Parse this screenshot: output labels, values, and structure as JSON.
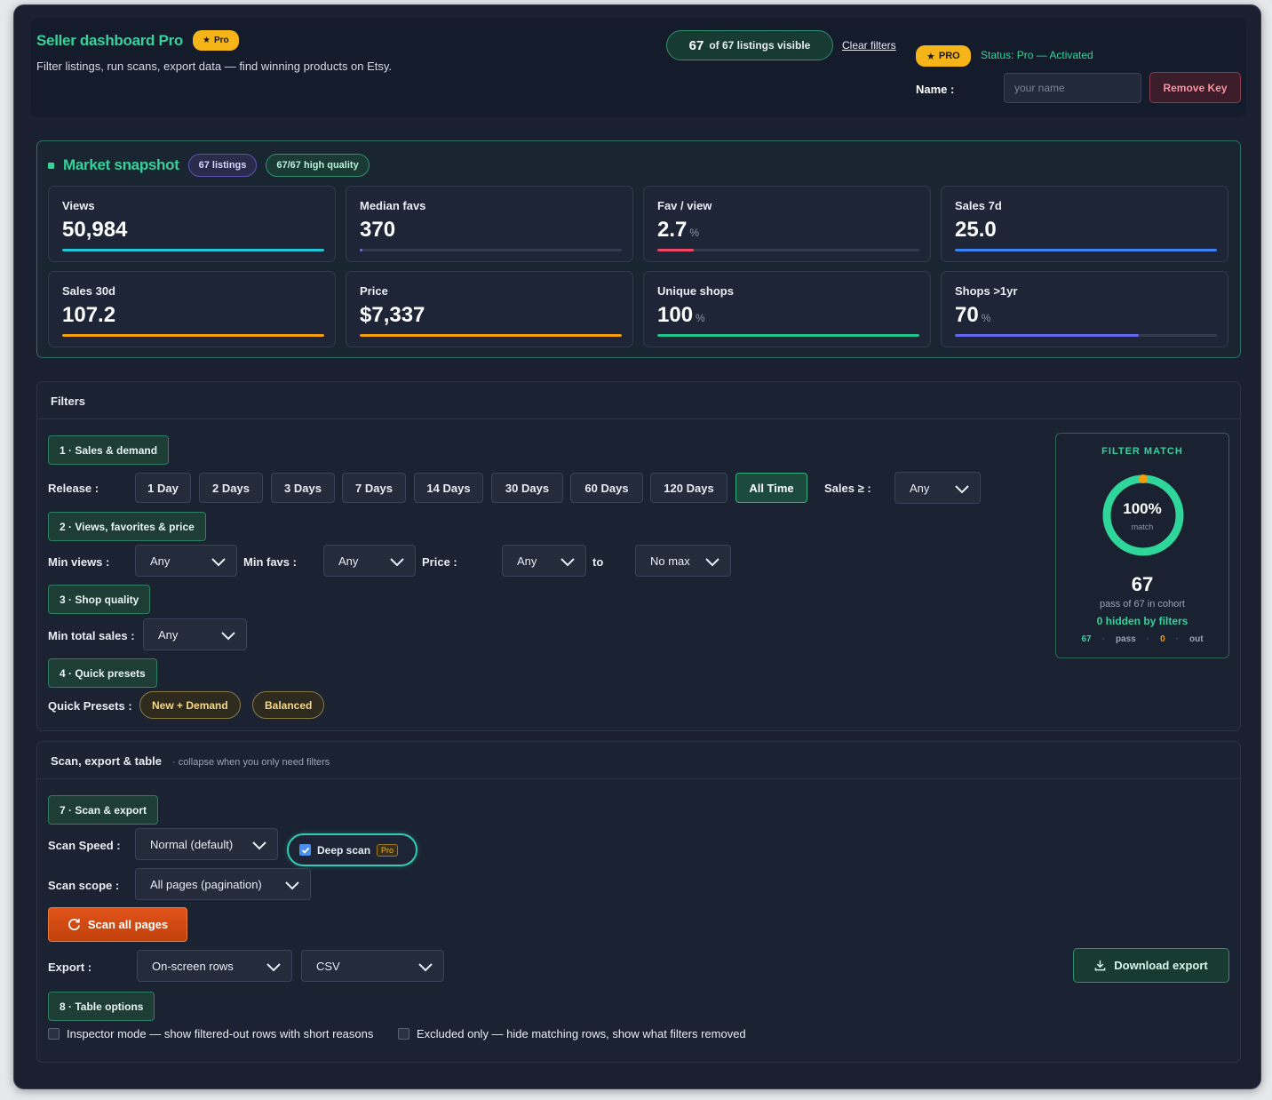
{
  "header": {
    "brand": "Seller dashboard Pro",
    "brand_badge": "Pro",
    "subtitle": "Filter listings, run scans, export data — find winning products on Etsy.",
    "visible_count": "67",
    "visible_text": "of 67 listings visible",
    "clear_filters": "Clear filters",
    "pro_badge": "PRO",
    "status": "Status: Pro — Activated",
    "name_label": "Name :",
    "name_placeholder": "your name",
    "remove_key": "Remove Key"
  },
  "market": {
    "title": "Market snapshot",
    "badge_listings": "67 listings",
    "badge_quality": "67/67 high quality",
    "stats": [
      {
        "label": "Views",
        "value": "50,984",
        "unit": "",
        "fill": 1.0,
        "color": "#22c4d8"
      },
      {
        "label": "Median favs",
        "value": "370",
        "unit": "",
        "fill": 0.01,
        "color": "#7c6cf0"
      },
      {
        "label": "Fav / view",
        "value": "2.7",
        "unit": "%",
        "fill": 0.14,
        "color": "#f04868"
      },
      {
        "label": "Sales 7d",
        "value": "25.0",
        "unit": "",
        "fill": 1.0,
        "color": "#3b82f6"
      },
      {
        "label": "Sales 30d",
        "value": "107.2",
        "unit": "",
        "fill": 1.0,
        "color": "#f59e0b"
      },
      {
        "label": "Price",
        "value": "$7,337",
        "unit": "",
        "fill": 1.0,
        "color": "#f59e0b"
      },
      {
        "label": "Unique shops",
        "value": "100",
        "unit": "%",
        "fill": 1.0,
        "color": "#22c48a"
      },
      {
        "label": "Shops >1yr",
        "value": "70",
        "unit": "%",
        "fill": 0.7,
        "color": "#6366f1"
      }
    ]
  },
  "filters": {
    "title": "Filters",
    "section1": "1 · Sales & demand",
    "release_label": "Release :",
    "release_options": [
      "1 Day",
      "2 Days",
      "3 Days",
      "7 Days",
      "14 Days",
      "30 Days",
      "60 Days",
      "120 Days",
      "All Time"
    ],
    "release_active": "All Time",
    "sales_label": "Sales ≥ :",
    "sales_value": "Any",
    "section2": "2 · Views, favorites & price",
    "min_views_label": "Min views :",
    "min_views_value": "Any",
    "min_favs_label": "Min favs :",
    "min_favs_value": "Any",
    "price_label": "Price :",
    "price_min": "Any",
    "price_to": "to",
    "price_max": "No max",
    "section3": "3 · Shop quality",
    "min_total_sales_label": "Min total sales :",
    "min_total_sales_value": "Any",
    "section4": "4 · Quick presets",
    "quick_presets_label": "Quick Presets :",
    "presets": [
      "New + Demand",
      "Balanced"
    ]
  },
  "match": {
    "title": "FILTER MATCH",
    "percent_text": "100%",
    "percent": 1.0,
    "sub": "match",
    "pass_count": "67",
    "pass_text": "pass of 67 in cohort",
    "hidden_text": "0 hidden by filters",
    "legend_pass_n": "67",
    "legend_pass": "pass",
    "legend_out_n": "0",
    "legend_out": "out",
    "colors": {
      "ring": "#2fd69a",
      "marker": "#f59e0b"
    }
  },
  "scan": {
    "title": "Scan, export & table",
    "subtitle": "· collapse when you only need filters",
    "section7": "7 · Scan & export",
    "speed_label": "Scan Speed :",
    "speed_value": "Normal (default)",
    "deep_scan": "Deep scan",
    "deep_scan_badge": "Pro",
    "deep_scan_checked": true,
    "scope_label": "Scan scope :",
    "scope_value": "All pages (pagination)",
    "scan_button": "Scan all pages",
    "export_label": "Export :",
    "export_rows": "On-screen rows",
    "export_format": "CSV",
    "download_button": "Download export",
    "section8": "8 · Table options",
    "inspector": "Inspector mode — show filtered-out rows with short reasons",
    "excluded": "Excluded only — hide matching rows, show what filters removed"
  }
}
